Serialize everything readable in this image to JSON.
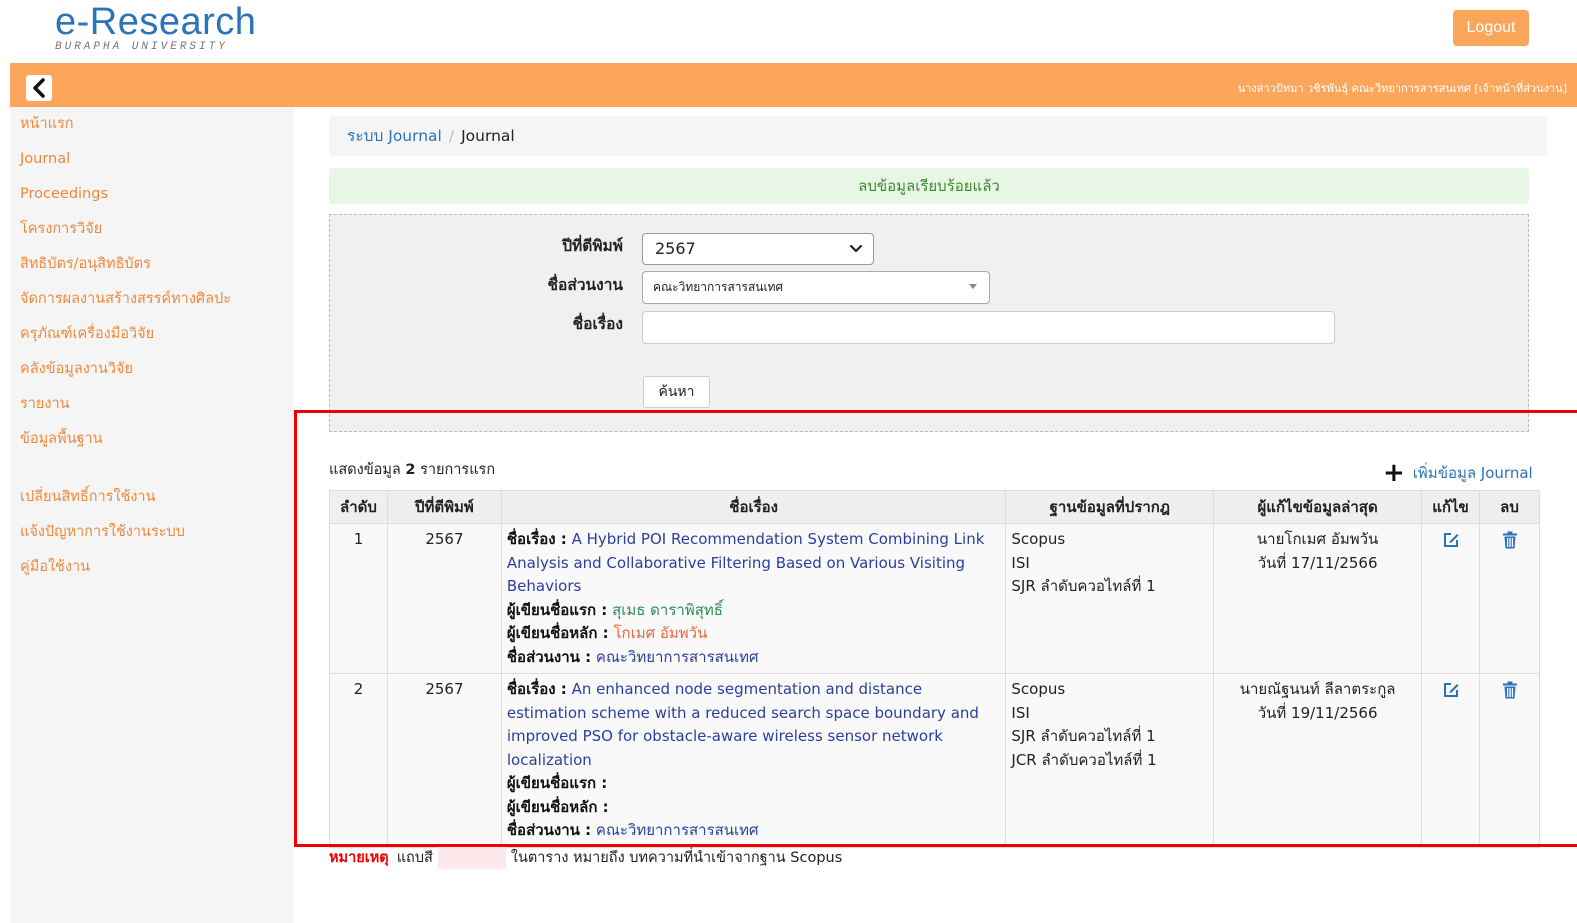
{
  "header": {
    "logo_main": "e-Research",
    "logo_sub": "BURAPHA UNIVERSITY",
    "logout_label": "Logout",
    "user_info": "นางสาวปัทมา วชิรพันธุ์ คณะวิทยาการสารสนเทศ [เจ้าหน้าที่ส่วนงาน]",
    "accent_color": "#fca65c"
  },
  "sidebar": {
    "items": [
      "หน้าแรก",
      "Journal",
      "Proceedings",
      "โครงการวิจัย",
      "สิทธิบัตร/อนุสิทธิบัตร",
      "จัดการผลงานสร้างสรรค์ทางศิลปะ",
      "ครุภัณฑ์เครื่องมือวิจัย",
      "คลังข้อมูลงานวิจัย",
      "รายงาน",
      "ข้อมูลพื้นฐาน"
    ],
    "secondary_items": [
      "เปลี่ยนสิทธิ์การใช้งาน",
      "แจ้งปัญหาการใช้งานระบบ",
      "คู่มือใช้งาน"
    ]
  },
  "breadcrumb": {
    "parent": "ระบบ Journal",
    "current": "Journal"
  },
  "alert": {
    "message": "ลบข้อมูลเรียบร้อยแล้ว"
  },
  "search_form": {
    "year_label": "ปีที่ตีพิมพ์",
    "year_value": "2567",
    "dept_label": "ชื่อส่วนงาน",
    "dept_value": "คณะวิทยาการสารสนเทศ",
    "title_label": "ชื่อเรื่อง",
    "title_value": "",
    "search_button": "ค้นหา"
  },
  "results": {
    "count_prefix": "แสดงข้อมูล",
    "count": "2",
    "count_suffix": "รายการแรก",
    "add_label": "เพิ่มข้อมูล Journal",
    "columns": [
      "ลำดับ",
      "ปีที่ตีพิมพ์",
      "ชื่อเรื่อง",
      "ฐานข้อมูลที่ปรากฎ",
      "ผู้แก้ไขข้อมูลล่าสุด",
      "แก้ไข",
      "ลบ"
    ],
    "field_labels": {
      "title": "ชื่อเรื่อง :",
      "first_author": "ผู้เขียนชื่อแรก :",
      "main_author": "ผู้เขียนชื่อหลัก :",
      "dept": "ชื่อส่วนงาน :"
    },
    "rows": [
      {
        "no": "1",
        "year": "2567",
        "title": "A Hybrid POI Recommendation System Combining Link Analysis and Collaborative Filtering Based on Various Visiting Behaviors",
        "first_author": "สุเมธ ดาราพิสุทธิ์",
        "main_author": "โกเมศ อัมพวัน",
        "dept": "คณะวิทยาการสารสนเทศ",
        "databases": [
          "Scopus",
          "ISI",
          "SJR ลำดับควอไทล์ที่ 1"
        ],
        "editor": "นายโกเมศ อัมพวัน",
        "edit_date": "วันที่ 17/11/2566"
      },
      {
        "no": "2",
        "year": "2567",
        "title": "An enhanced node segmentation and distance estimation scheme with a reduced search space boundary and improved PSO for obstacle-aware wireless sensor network localization",
        "first_author": "",
        "main_author": "",
        "dept": "คณะวิทยาการสารสนเทศ",
        "databases": [
          "Scopus",
          "ISI",
          "SJR ลำดับควอไทล์ที่ 1",
          "JCR ลำดับควอไทล์ที่ 1"
        ],
        "editor": "นายณัฐนนท์ ลีลาตระกูล",
        "edit_date": "วันที่ 19/11/2566"
      }
    ]
  },
  "note": {
    "label": "หมายเหตุ",
    "text_before": "แถบสี",
    "text_after": "ในตาราง หมายถึง บทความที่นำเข้าจากฐาน Scopus",
    "swatch_color": "#fde8ec"
  }
}
